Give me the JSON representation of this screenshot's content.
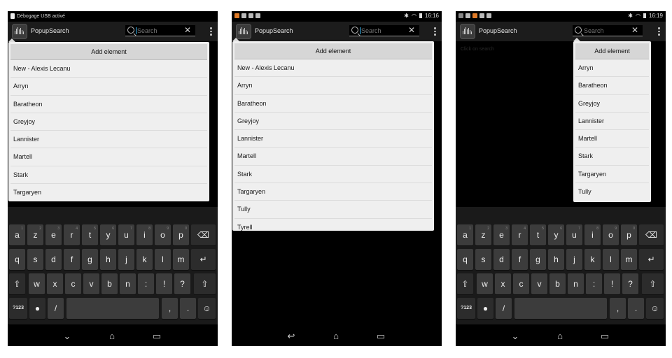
{
  "screens": [
    {
      "status": {
        "text": "Débogage USB activé",
        "time": ""
      },
      "app_title": "PopupSearch",
      "search_placeholder": "Search",
      "add_label": "Add element",
      "items": [
        "New - Alexis Lecanu",
        "Arryn",
        "Baratheon",
        "Greyjoy",
        "Lannister",
        "Martell",
        "Stark",
        "Targaryen"
      ],
      "keyboard": true
    },
    {
      "status": {
        "text": "",
        "time": "16:16"
      },
      "app_title": "PopupSearch",
      "search_placeholder": "Search",
      "add_label": "Add element",
      "items": [
        "New - Alexis Lecanu",
        "Arryn",
        "Baratheon",
        "Greyjoy",
        "Lannister",
        "Martell",
        "Stark",
        "Targaryen",
        "Tully",
        "Tyrell"
      ],
      "keyboard": false
    },
    {
      "status": {
        "text": "",
        "time": "16:19"
      },
      "app_title": "PopupSearch",
      "search_placeholder": "Search",
      "hint": "Click on search",
      "add_label": "Add element",
      "items": [
        "Arryn",
        "Baratheon",
        "Greyjoy",
        "Lannister",
        "Martell",
        "Stark",
        "Targaryen",
        "Tully"
      ],
      "keyboard": true
    }
  ],
  "keyboard": {
    "row1": [
      "a",
      "z",
      "e",
      "r",
      "t",
      "y",
      "u",
      "i",
      "o",
      "p"
    ],
    "row1_digits": [
      "1",
      "2",
      "3",
      "4",
      "5",
      "6",
      "7",
      "8",
      "9",
      "0"
    ],
    "row2": [
      "q",
      "s",
      "d",
      "f",
      "g",
      "h",
      "j",
      "k",
      "l",
      "m"
    ],
    "row3": [
      "w",
      "x",
      "c",
      "v",
      "b",
      "n",
      ":",
      "!",
      "?"
    ],
    "symbols_label": "?123",
    "comma": ",",
    "period": ".",
    "slash": "/"
  },
  "icons": {
    "backspace": "backspace-icon",
    "enter": "enter-icon",
    "shift": "shift-icon",
    "mic": "microphone-icon",
    "emoji": "emoji-icon",
    "back": "back-icon",
    "home": "home-icon",
    "recents": "recents-icon"
  },
  "colors": {
    "accent": "#3ac0ff",
    "popup_bg": "#efefef",
    "key_bg": "#3c3c3c"
  }
}
